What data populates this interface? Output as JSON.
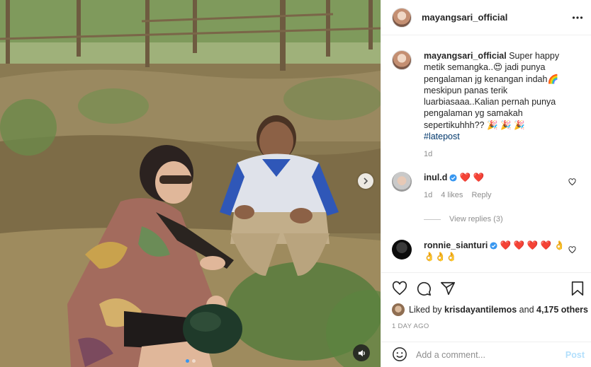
{
  "post": {
    "username": "mayangsari_official",
    "more_icon": "more-horizontal-icon",
    "caption": {
      "username": "mayangsari_official",
      "text": "Super happy metik semangka..😍 jadi punya pengalaman jg kenangan indah🌈 meskipun panas terik luarbiasaaa..Kalian pernah punya pengalaman yg samakah sepertikuhhh?? 🎉 🎉 🎉",
      "hashtag": "#latepost",
      "time": "1d"
    },
    "comments": [
      {
        "username": "inul.d",
        "verified": true,
        "text": "❤️ ❤️",
        "time": "1d",
        "likes": "4 likes",
        "reply": "Reply"
      },
      {
        "username": "ronnie_sianturi",
        "verified": true,
        "text": "❤️ ❤️ ❤️ ❤️ 👌 👌👌👌",
        "time": "",
        "likes": "",
        "reply": ""
      }
    ],
    "view_replies": "View replies (3)",
    "liked_by_prefix": "Liked by",
    "liked_by_user": "krisdayantilemos",
    "liked_by_and": "and",
    "liked_by_others": "4,175 others",
    "timestamp": "1 DAY AGO",
    "comment_placeholder": "Add a comment...",
    "post_button": "Post",
    "colors": {
      "link_blue": "#00376b",
      "verified_blue": "#3897f0",
      "post_disabled": "#b2dffc",
      "heart_red": "#ed4956"
    }
  }
}
